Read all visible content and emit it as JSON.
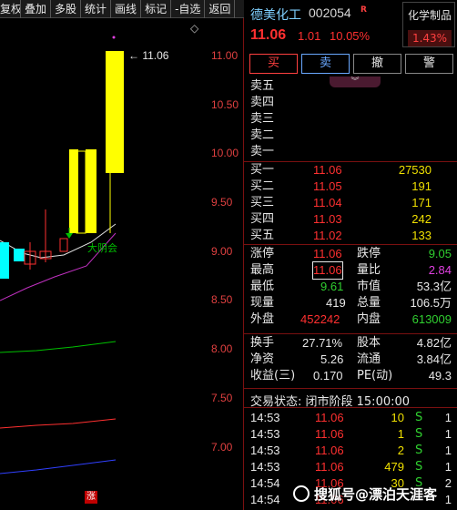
{
  "toolbar": {
    "buttons": [
      "复权",
      "叠加",
      "多股",
      "统计",
      "画线",
      "标记",
      "-自选",
      "返回"
    ]
  },
  "chart": {
    "price_labels": [
      "11.00",
      "10.50",
      "10.00",
      "9.50",
      "9.00",
      "8.50",
      "8.00",
      "7.50",
      "7.00"
    ],
    "high_label": "11.06",
    "diamond": "◇",
    "annotation": "大阴会",
    "zhang_badge": "涨",
    "colors": {
      "up": "#ffff00",
      "down": "#00ffff",
      "ma5": "#e0e0e0",
      "ma10": "#c030c0",
      "ma_green": "#00c000",
      "ma_red": "#ff3030",
      "ma_blue": "#3040ff"
    }
  },
  "quote": {
    "name": "德美化工",
    "code": "002054",
    "rmark": "R",
    "price": "11.06",
    "change": "1.01",
    "change_pct": "10.05%",
    "sector_name": "化学制品",
    "sector_pct": "1.43%"
  },
  "actions": {
    "buy": "买",
    "sell": "卖",
    "cancel": "撤",
    "warn": "警"
  },
  "asks": [
    {
      "label": "卖五",
      "price": "",
      "vol": ""
    },
    {
      "label": "卖四",
      "price": "",
      "vol": ""
    },
    {
      "label": "卖三",
      "price": "",
      "vol": ""
    },
    {
      "label": "卖二",
      "price": "",
      "vol": ""
    },
    {
      "label": "卖一",
      "price": "",
      "vol": ""
    }
  ],
  "bids": [
    {
      "label": "买一",
      "price": "11.06",
      "vol": "27530"
    },
    {
      "label": "买二",
      "price": "11.05",
      "vol": "191"
    },
    {
      "label": "买三",
      "price": "11.04",
      "vol": "171"
    },
    {
      "label": "买四",
      "price": "11.03",
      "vol": "242"
    },
    {
      "label": "买五",
      "price": "11.02",
      "vol": "133"
    }
  ],
  "stats1": [
    {
      "l1": "涨停",
      "v1": "11.06",
      "l2": "跌停",
      "v2": "9.05"
    },
    {
      "l1": "最高",
      "v1": "11.06",
      "l2": "量比",
      "v2": "2.84"
    },
    {
      "l1": "最低",
      "v1": "9.61",
      "l2": "市值",
      "v2": "53.3亿"
    },
    {
      "l1": "现量",
      "v1": "419",
      "l2": "总量",
      "v2": "106.5万"
    },
    {
      "l1": "外盘",
      "v1": "452242",
      "l2": "内盘",
      "v2": "613009"
    }
  ],
  "stats2": [
    {
      "l1": "换手",
      "v1": "27.71%",
      "l2": "股本",
      "v2": "4.82亿"
    },
    {
      "l1": "净资",
      "v1": "5.26",
      "l2": "流通",
      "v2": "3.84亿"
    },
    {
      "l1": "收益(三)",
      "v1": "0.170",
      "l2": "PE(动)",
      "v2": "49.3"
    }
  ],
  "trade_status": "交易状态: 闭市阶段 15:00:00",
  "ticks": [
    {
      "time": "14:53",
      "price": "11.06",
      "vol": "10",
      "side": "S",
      "n": "1"
    },
    {
      "time": "14:53",
      "price": "11.06",
      "vol": "1",
      "side": "S",
      "n": "1"
    },
    {
      "time": "14:53",
      "price": "11.06",
      "vol": "2",
      "side": "S",
      "n": "1"
    },
    {
      "time": "14:53",
      "price": "11.06",
      "vol": "479",
      "side": "S",
      "n": "1"
    },
    {
      "time": "14:54",
      "price": "11.06",
      "vol": "30",
      "side": "S",
      "n": "2"
    },
    {
      "time": "14:54",
      "price": "11.06",
      "vol": "",
      "side": "",
      "n": "1"
    }
  ],
  "watermark": "搜狐号@漂泊天涯客"
}
